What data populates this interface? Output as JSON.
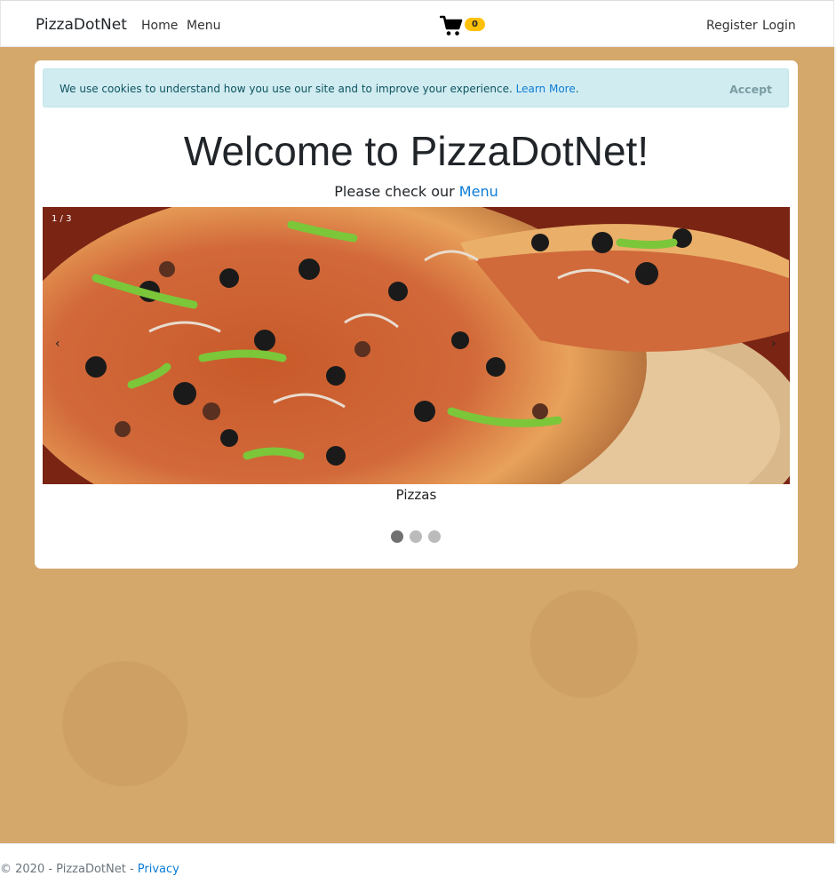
{
  "navbar": {
    "brand": "PizzaDotNet",
    "links": [
      {
        "label": "Home"
      },
      {
        "label": "Menu"
      }
    ],
    "cart_count": "0",
    "right_links": [
      {
        "label": "Register"
      },
      {
        "label": "Login"
      }
    ]
  },
  "cookie_notice": {
    "text": "We use cookies to understand how you use our site and to improve your experience.",
    "link": "Learn More",
    "period": ".",
    "accept": "Accept"
  },
  "hero": {
    "title": "Welcome to PizzaDotNet!",
    "subtitle_prefix": "Please check our",
    "subtitle_link": "Menu"
  },
  "carousel": {
    "counter": "1 / 3",
    "caption": "Pizzas",
    "prev_glyph": "‹",
    "next_glyph": "›",
    "active_slide": 1,
    "total_slides": 3
  },
  "footer": {
    "copyright": "© 2020 - PizzaDotNet -",
    "privacy": "Privacy"
  },
  "colors": {
    "background": "#d4a76a",
    "badge": "#ffc107",
    "cookie_bg": "#d1ecf1",
    "link": "#0c7cd5"
  }
}
